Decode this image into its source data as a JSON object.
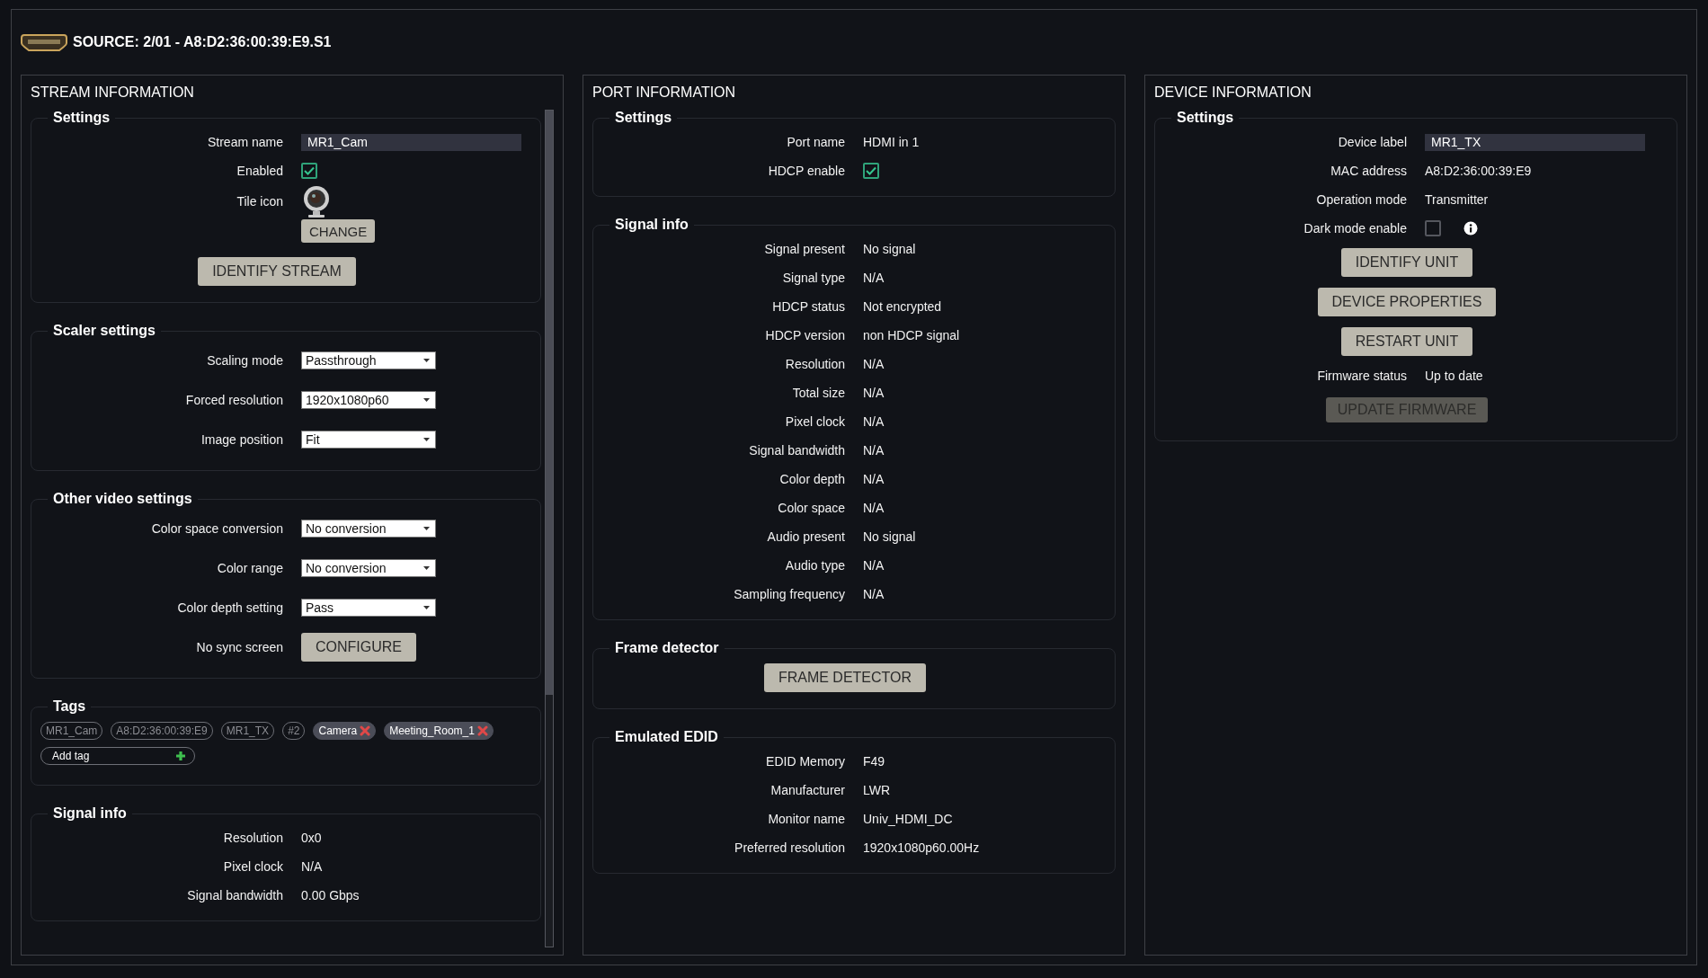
{
  "header": {
    "title": "SOURCE: 2/01 - A8:D2:36:00:39:E9.S1"
  },
  "panels": [
    {
      "title": "STREAM INFORMATION",
      "scrollable": true,
      "sections": [
        {
          "title": "Settings",
          "rows": [
            {
              "kind": "input",
              "label": "Stream name",
              "value": "MR1_Cam"
            },
            {
              "kind": "checkbox",
              "label": "Enabled",
              "checked": true,
              "info": false
            },
            {
              "kind": "tile",
              "label": "Tile icon",
              "button": "CHANGE"
            },
            {
              "kind": "button",
              "text": "IDENTIFY STREAM",
              "disabled": false
            }
          ]
        },
        {
          "title": "Scaler settings",
          "rows": [
            {
              "kind": "select",
              "label": "Scaling mode",
              "value": "Passthrough"
            },
            {
              "kind": "select",
              "label": "Forced resolution",
              "value": "1920x1080p60"
            },
            {
              "kind": "select",
              "label": "Image position",
              "value": "Fit"
            }
          ]
        },
        {
          "title": "Other video settings",
          "rows": [
            {
              "kind": "select",
              "label": "Color space conversion",
              "value": "No conversion"
            },
            {
              "kind": "select",
              "label": "Color range",
              "value": "No conversion"
            },
            {
              "kind": "select",
              "label": "Color depth setting",
              "value": "Pass"
            },
            {
              "kind": "labeled_button",
              "label": "No sync screen",
              "button": "CONFIGURE"
            }
          ]
        },
        {
          "title": "Tags",
          "rows": [
            {
              "kind": "tags",
              "tags": [
                {
                  "text": "MR1_Cam",
                  "removable": false
                },
                {
                  "text": "A8:D2:36:00:39:E9",
                  "removable": false
                },
                {
                  "text": "MR1_TX",
                  "removable": false
                },
                {
                  "text": "#2",
                  "removable": false
                },
                {
                  "text": "Camera",
                  "removable": true
                },
                {
                  "text": "Meeting_Room_1",
                  "removable": true
                }
              ],
              "placeholder": "Add tag"
            }
          ]
        },
        {
          "title": "Signal info",
          "rows": [
            {
              "kind": "text",
              "label": "Resolution",
              "value": "0x0"
            },
            {
              "kind": "text",
              "label": "Pixel clock",
              "value": "N/A"
            },
            {
              "kind": "text",
              "label": "Signal bandwidth",
              "value": "0.00 Gbps"
            }
          ]
        }
      ]
    },
    {
      "title": "PORT INFORMATION",
      "scrollable": false,
      "sections": [
        {
          "title": "Settings",
          "rows": [
            {
              "kind": "text",
              "label": "Port name",
              "value": "HDMI in 1"
            },
            {
              "kind": "checkbox",
              "label": "HDCP enable",
              "checked": true,
              "info": false
            }
          ]
        },
        {
          "title": "Signal info",
          "rows": [
            {
              "kind": "text",
              "label": "Signal present",
              "value": "No signal"
            },
            {
              "kind": "text",
              "label": "Signal type",
              "value": "N/A"
            },
            {
              "kind": "text",
              "label": "HDCP status",
              "value": "Not encrypted"
            },
            {
              "kind": "text",
              "label": "HDCP version",
              "value": "non HDCP signal"
            },
            {
              "kind": "text",
              "label": "Resolution",
              "value": "N/A"
            },
            {
              "kind": "text",
              "label": "Total size",
              "value": "N/A"
            },
            {
              "kind": "text",
              "label": "Pixel clock",
              "value": "N/A"
            },
            {
              "kind": "text",
              "label": "Signal bandwidth",
              "value": "N/A"
            },
            {
              "kind": "text",
              "label": "Color depth",
              "value": "N/A"
            },
            {
              "kind": "text",
              "label": "Color space",
              "value": "N/A"
            },
            {
              "kind": "text",
              "label": "Audio present",
              "value": "No signal"
            },
            {
              "kind": "text",
              "label": "Audio type",
              "value": "N/A"
            },
            {
              "kind": "text",
              "label": "Sampling frequency",
              "value": "N/A"
            }
          ]
        },
        {
          "title": "Frame detector",
          "rows": [
            {
              "kind": "button",
              "text": "FRAME DETECTOR",
              "disabled": false
            }
          ]
        },
        {
          "title": "Emulated EDID",
          "rows": [
            {
              "kind": "text",
              "label": "EDID Memory",
              "value": "F49"
            },
            {
              "kind": "text",
              "label": "Manufacturer",
              "value": "LWR"
            },
            {
              "kind": "text",
              "label": "Monitor name",
              "value": "Univ_HDMI_DC"
            },
            {
              "kind": "text",
              "label": "Preferred resolution",
              "value": "1920x1080p60.00Hz"
            }
          ]
        }
      ]
    },
    {
      "title": "DEVICE INFORMATION",
      "scrollable": false,
      "sections": [
        {
          "title": "Settings",
          "rows": [
            {
              "kind": "input",
              "label": "Device label",
              "value": "MR1_TX"
            },
            {
              "kind": "text",
              "label": "MAC address",
              "value": "A8:D2:36:00:39:E9"
            },
            {
              "kind": "text",
              "label": "Operation mode",
              "value": "Transmitter"
            },
            {
              "kind": "checkbox",
              "label": "Dark mode enable",
              "checked": false,
              "info": true
            },
            {
              "kind": "button",
              "text": "IDENTIFY UNIT",
              "disabled": false
            },
            {
              "kind": "button",
              "text": "DEVICE PROPERTIES",
              "disabled": false
            },
            {
              "kind": "button",
              "text": "RESTART UNIT",
              "disabled": false
            },
            {
              "kind": "text",
              "label": "Firmware status",
              "value": "Up to date"
            },
            {
              "kind": "button",
              "text": "UPDATE FIRMWARE",
              "disabled": true
            }
          ]
        }
      ]
    }
  ]
}
